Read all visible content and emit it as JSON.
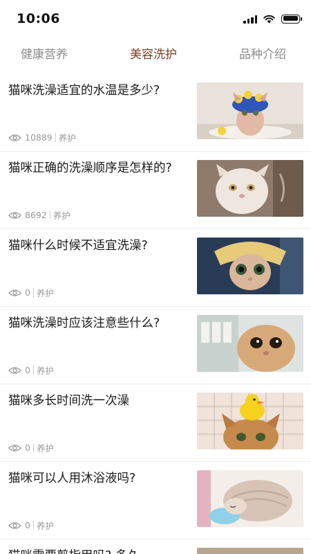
{
  "status_bar": {
    "time": "10:06"
  },
  "tabs": [
    {
      "label": "健康营养",
      "active": false
    },
    {
      "label": "美容洗护",
      "active": true
    },
    {
      "label": "品种介绍",
      "active": false
    }
  ],
  "articles": [
    {
      "title": "猫咪洗澡适宜的水温是多少?",
      "views": "10889",
      "tag": "养护",
      "thumbnail": "cat-with-shower-cap-image"
    },
    {
      "title": "猫咪正确的洗澡顺序是怎样的?",
      "views": "8692",
      "tag": "养护",
      "thumbnail": "white-persian-cat-image"
    },
    {
      "title": "猫咪什么时候不适宜洗澡?",
      "views": "0",
      "tag": "养护",
      "thumbnail": "wet-kitten-in-towel-image"
    },
    {
      "title": "猫咪洗澡时应该注意些什么?",
      "views": "0",
      "tag": "养护",
      "thumbnail": "wet-cat-close-up-image"
    },
    {
      "title": "猫咪多长时间洗一次澡",
      "views": "0",
      "tag": "养护",
      "thumbnail": "cat-with-rubber-duck-image"
    },
    {
      "title": "猫咪可以人用沐浴液吗?",
      "views": "0",
      "tag": "养护",
      "thumbnail": "sleeping-wet-kitten-image"
    }
  ],
  "peek_article": {
    "title": "猫咪需要剪指甲吗? 多久"
  },
  "colors": {
    "active_tab": "#7a3b1e",
    "inactive_tab": "#8c8c8c",
    "meta_text": "#9a9a9a"
  }
}
